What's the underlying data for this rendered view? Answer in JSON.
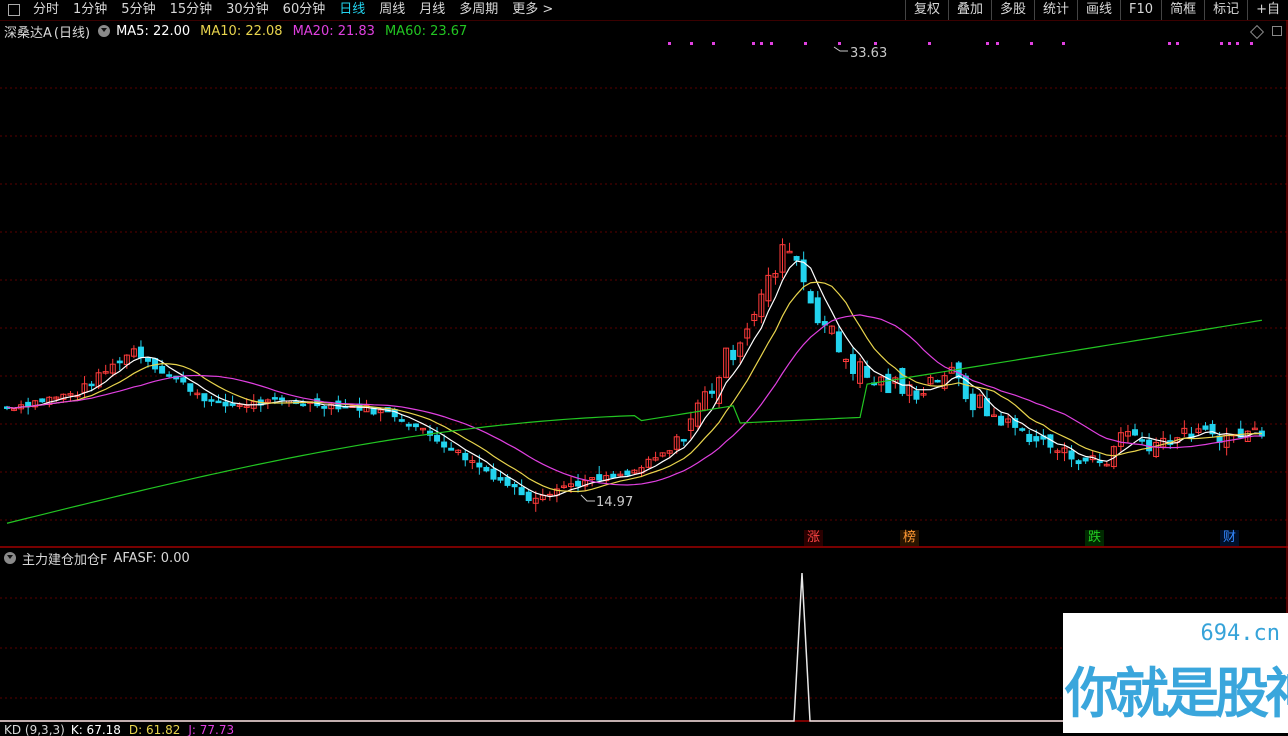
{
  "toolbar": {
    "periods": [
      "分时",
      "1分钟",
      "5分钟",
      "15分钟",
      "30分钟",
      "60分钟",
      "日线",
      "周线",
      "月线",
      "多周期",
      "更多 >"
    ],
    "active_period": "日线",
    "tools": [
      "复权",
      "叠加",
      "多股",
      "统计",
      "画线",
      "F10",
      "简框",
      "标记",
      "+自"
    ]
  },
  "main_legend": {
    "stock": "深桑达A",
    "period_label": "(日线)",
    "ma5": "MA5: 22.00",
    "ma10": "MA10: 22.08",
    "ma20": "MA20: 21.83",
    "ma60": "MA60: 23.67"
  },
  "colors": {
    "up": "#ff3b3b",
    "down": "#22d3ee",
    "ma5": "#ffffff",
    "ma10": "#e8d44d",
    "ma20": "#e040e0",
    "ma60": "#22c522",
    "grid": "#5a0000"
  },
  "annotations": {
    "high": "33.63",
    "low": "14.97"
  },
  "badges": [
    {
      "text": "涨",
      "color": "#ff4444"
    },
    {
      "text": "榜",
      "color": "#ff9933"
    },
    {
      "text": "跌",
      "color": "#22cc22"
    },
    {
      "text": "财",
      "color": "#3388ff"
    }
  ],
  "sub_legend": {
    "indicator": "主力建仓加仓F",
    "value": "AFASF: 0.00"
  },
  "kd_legend": {
    "name": "KD (9,3,3)",
    "k": "K: 67.18",
    "d": "D: 61.82",
    "j": "J: 77.73"
  },
  "watermark": {
    "site": "694.cn",
    "slogan": "你就是股神"
  }
}
